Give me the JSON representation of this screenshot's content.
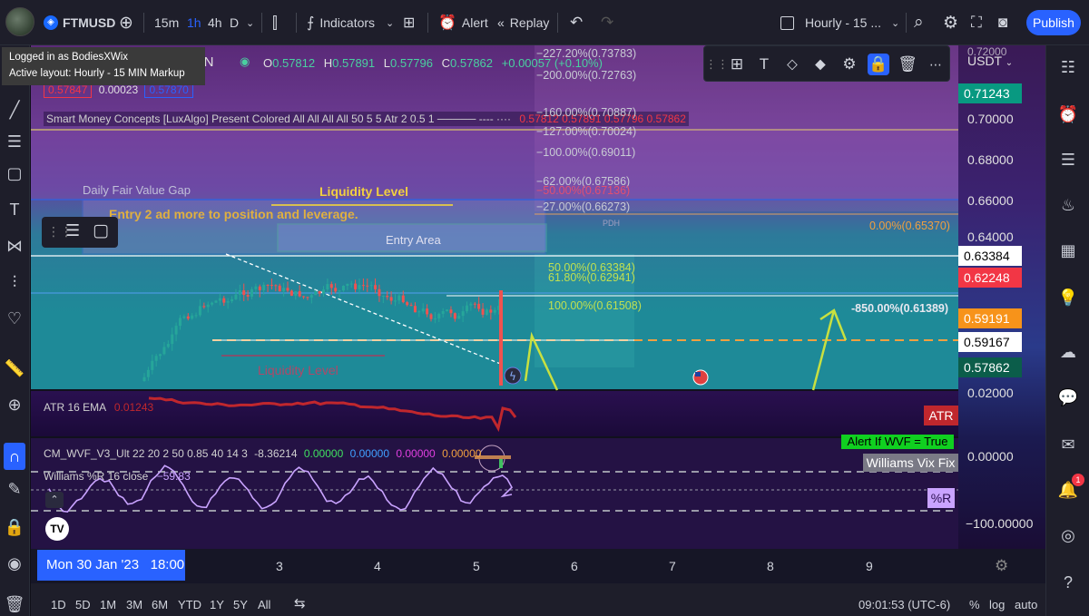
{
  "header": {
    "symbol": "FTMUSD",
    "intervals": [
      "15m",
      "1h",
      "4h",
      "D"
    ],
    "active_interval": "1h",
    "indicators_label": "Indicators",
    "alert_label": "Alert",
    "replay_label": "Replay",
    "layout_name": "Hourly - 15 ...",
    "publish_label": "Publish"
  },
  "tooltip": {
    "line1": "Logged in as BodiesXWix",
    "line2": "Active layout: Hourly - 15 MIN Markup"
  },
  "quote": {
    "name": "COIN",
    "o_label": "O",
    "o": "0.57812",
    "h_label": "H",
    "h": "0.57891",
    "l_label": "L",
    "l": "0.57796",
    "c_label": "C",
    "c": "0.57862",
    "change": "+0.00057 (+0.10%)",
    "bid": "0.57847",
    "spread": "0.00023",
    "ask": "0.57870"
  },
  "indicators": {
    "smc": "Smart Money Concepts [LuxAlgo] Present Colored All All All All 50 5 5 Atr 2 0.5 1 ───── ---- ····",
    "smc_values": "0.57812 0.57891 0.57796 0.57862",
    "atr_label": "ATR 16 EMA",
    "atr_value": "0.01243",
    "atr_tag": "ATR",
    "wvf_label": "CM_WVF_V3_Ult 22 20 2 50 0.85 40 14 3",
    "wvf_v1": "-8.36214",
    "wvf_v2": "0.00000",
    "wvf_v3": "0.00000",
    "wvf_v4": "0.00000",
    "wvf_v5": "0.00000",
    "wvf_alert": "Alert If WVF = True",
    "wvf_tag": "Williams Vix Fix",
    "wr_label": "Williams %R 16 close",
    "wr_value": "−59.83",
    "wr_tag": "%R"
  },
  "annotations": {
    "daily_fvg": "Daily  Fair Value Gap",
    "liquidity_top": "Liquidity Level",
    "entry2": "Entry 2  ad more to position and leverage.",
    "entry_area": "Entry Area",
    "liquidity_bottom": "Liquidity Level",
    "pdh": "PDH",
    "fib_zero": "0.00%(0.65370)",
    "fib_right": "-850.00%(0.61389)",
    "fib": [
      "−227.20%(0.73783)",
      "−200.00%(0.72763)",
      "−160.00%(0.70887)",
      "−127.00%(0.70024)",
      "−100.00%(0.69011)",
      "−62.00%(0.67586)",
      "−50.00%(0.67136)",
      "−27.00%(0.66273)",
      "50.00%(0.63384)",
      "61.80%(0.62941)",
      "100.00%(0.61508)"
    ]
  },
  "price_scale": {
    "currency": "USDT",
    "labels": [
      "0.72000",
      "0.70000",
      "0.68000",
      "0.66000",
      "0.64000",
      "0.02000",
      "0.00000",
      "−100.00000"
    ],
    "tags": [
      {
        "text": "0.71243",
        "bg": "#089981",
        "fg": "#ffffff"
      },
      {
        "text": "0.63384",
        "bg": "#ffffff",
        "fg": "#000000"
      },
      {
        "text": "0.62248",
        "bg": "#f23645",
        "fg": "#ffffff"
      },
      {
        "text": "0.59191",
        "bg": "#f7931a",
        "fg": "#ffffff"
      },
      {
        "text": "0.59167",
        "bg": "#ffffff",
        "fg": "#000000"
      },
      {
        "text": "0.57862",
        "bg": "#0b5d4a",
        "fg": "#ffffff"
      }
    ]
  },
  "time_axis": {
    "current": "Mon 30 Jan '23   18:00",
    "labels": [
      "3",
      "4",
      "5",
      "6",
      "7",
      "8",
      "9"
    ]
  },
  "bottom_bar": {
    "ranges": [
      "1D",
      "5D",
      "1M",
      "3M",
      "6M",
      "YTD",
      "1Y",
      "5Y",
      "All"
    ],
    "clock": "09:01:53 (UTC-6)",
    "percent": "%",
    "log": "log",
    "auto": "auto"
  },
  "notification_count": "1",
  "colors": {
    "accent": "#2962ff",
    "up_candle": "#26a69a",
    "down_candle": "#ef5350",
    "fib_label": "#f0e442",
    "liquidity_label": "#e0b040",
    "atr_line": "#c0272d",
    "wr_line": "#c9a3ff"
  }
}
